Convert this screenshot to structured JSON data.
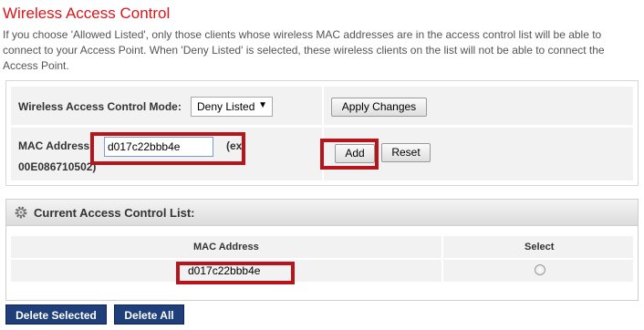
{
  "page": {
    "title": "Wireless Access Control",
    "description": "If you choose 'Allowed Listed', only those clients whose wireless MAC addresses are in the access control list will be able to connect to your Access Point. When 'Deny Listed' is selected, these wireless clients on the list will not be able to connect the Access Point."
  },
  "settings": {
    "mode_label": "Wireless Access Control Mode:",
    "mode_value": "Deny Listed",
    "apply_label": "Apply Changes",
    "mac_label": "MAC Address:",
    "mac_value": "d017c22bbb4e",
    "mac_hint_1": "(ex.",
    "mac_hint_2": "00E086710502)",
    "add_label": "Add",
    "reset_label": "Reset"
  },
  "list": {
    "title": "Current Access Control List:",
    "columns": [
      "MAC Address",
      "Select"
    ],
    "rows": [
      {
        "mac": "d017c22bbb4e"
      }
    ]
  },
  "actions": {
    "delete_selected": "Delete Selected",
    "delete_all": "Delete All"
  },
  "colors": {
    "title_red": "#d9161a",
    "highlight_red": "#b7151c",
    "button_navy": "#1f3f7a"
  }
}
